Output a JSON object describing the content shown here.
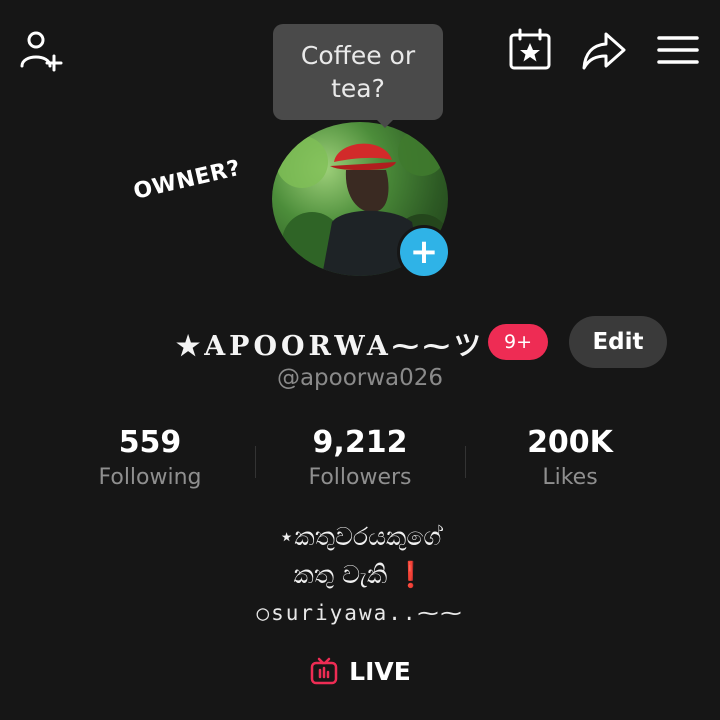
{
  "topbar": {
    "add_friend_icon": "person-plus-icon",
    "calendar_icon": "calendar-star-icon",
    "share_icon": "share-arrow-icon",
    "menu_icon": "hamburger-menu-icon"
  },
  "note_bubble": {
    "line1": "Coffee or",
    "line2": "tea?"
  },
  "overlay_label": "OWNER?",
  "profile": {
    "display_name": "★APOORWA⁓⁓ツ",
    "badge": "9+",
    "edit_label": "Edit",
    "handle": "@apoorwa026"
  },
  "stats": [
    {
      "value": "559",
      "label": "Following"
    },
    {
      "value": "9,212",
      "label": "Followers"
    },
    {
      "value": "200K",
      "label": "Likes"
    }
  ],
  "bio": {
    "line1": "⋆කතුවරයකුගේ",
    "line2": "කතු වැකි",
    "line2_mark": "❗",
    "line3": "○suriyawa..⁓⁓"
  },
  "live_label": "LIVE",
  "colors": {
    "background": "#161616",
    "badge": "#ee2c54",
    "add_story": "#2fb3e7",
    "live_icon": "#ee2c54"
  }
}
